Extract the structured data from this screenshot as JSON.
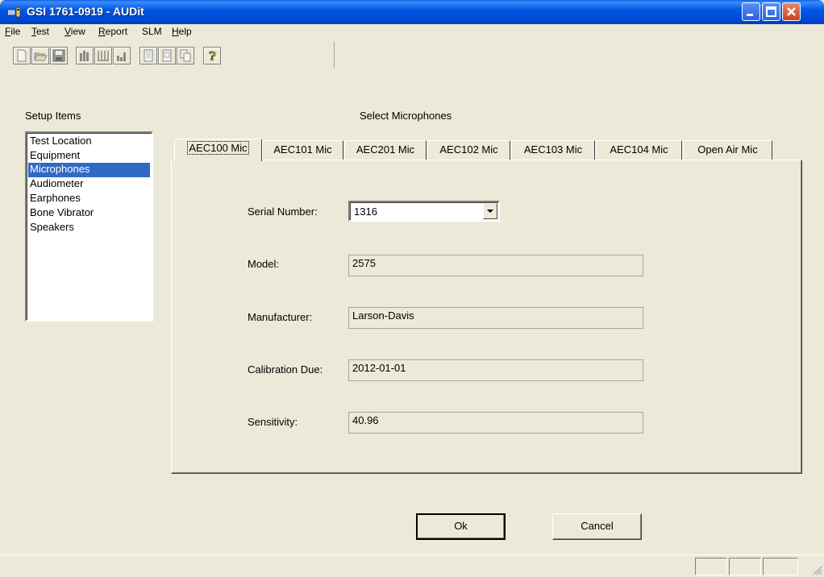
{
  "window": {
    "title": "GSI 1761-0919 - AUDit"
  },
  "menu": [
    {
      "label": "File",
      "u": "F",
      "rest": "ile"
    },
    {
      "label": "Test",
      "u": "T",
      "rest": "est"
    },
    {
      "label": "View",
      "u": "V",
      "rest": "iew"
    },
    {
      "label": "Report",
      "u": "R",
      "rest": "eport"
    },
    {
      "label": "SLM",
      "u": "",
      "rest": "SLM"
    },
    {
      "label": "Help",
      "u": "H",
      "rest": "elp"
    }
  ],
  "toolbar": {
    "icons": [
      "new-icon",
      "open-icon",
      "save-icon",
      "bar-chart-icon",
      "columns-icon",
      "graph-icon",
      "page-icon",
      "document-icon",
      "copy-icon",
      "help-icon"
    ]
  },
  "setup": {
    "label": "Setup Items",
    "items": [
      "Test Location",
      "Equipment",
      "Microphones",
      "Audiometer",
      "Earphones",
      "Bone Vibrator",
      "Speakers"
    ],
    "selected": "Microphones"
  },
  "microphones": {
    "heading": "Select Microphones",
    "tabs": [
      "AEC100 Mic",
      "AEC101 Mic",
      "AEC201 Mic",
      "AEC102 Mic",
      "AEC103 Mic",
      "AEC104 Mic",
      "Open Air Mic"
    ],
    "active_tab": "AEC100 Mic",
    "fields": {
      "serial_label": "Serial Number:",
      "serial_value": "1316",
      "model_label": "Model:",
      "model_value": "2575",
      "manufacturer_label": "Manufacturer:",
      "manufacturer_value": "Larson-Davis",
      "calibration_label": "Calibration Due:",
      "calibration_value": "2012-01-01",
      "sensitivity_label": "Sensitivity:",
      "sensitivity_value": "40.96"
    }
  },
  "buttons": {
    "ok": "Ok",
    "cancel": "Cancel"
  },
  "colors": {
    "titlebar": "#0054e3",
    "selection": "#316ac5",
    "face": "#ece9d8"
  }
}
